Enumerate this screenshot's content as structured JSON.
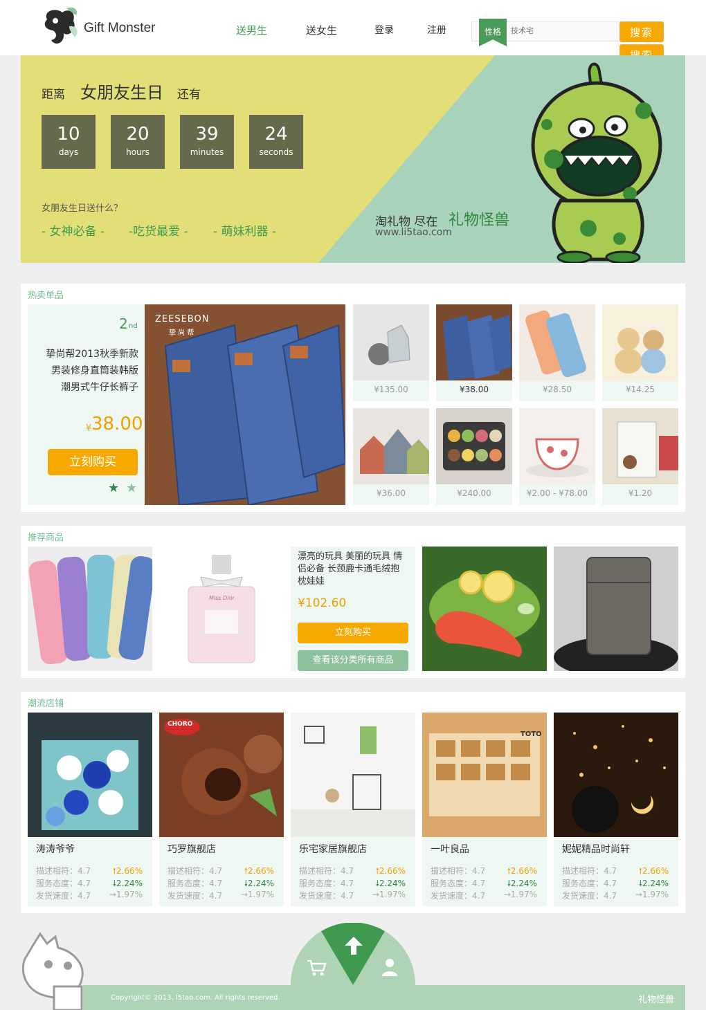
{
  "header": {
    "logo_text": "Gift Monster",
    "nav": [
      "送男生",
      "送女生",
      "登录",
      "注册"
    ],
    "search_tag": "性格",
    "search_placeholder": "技术宅",
    "search_button": "搜索"
  },
  "banner": {
    "prefix": "距离",
    "event": "女朋友生日",
    "suffix": "还有",
    "countdown": [
      {
        "num": "10",
        "unit": "days"
      },
      {
        "num": "20",
        "unit": "hours"
      },
      {
        "num": "39",
        "unit": "minutes"
      },
      {
        "num": "24",
        "unit": "seconds"
      }
    ],
    "question": "女朋友生日送什么？",
    "links": [
      "- 女神必备 -",
      "-吃货最爱 -",
      "- 萌妹利器 -"
    ],
    "slogan_a": "淘礼物 尽在",
    "slogan_b": "礼物怪兽",
    "site": "www.li5tao.com"
  },
  "hot": {
    "title": "热卖单品",
    "rank": "2",
    "rank_suffix": "nd",
    "product_name": [
      "挚尚帮2013秋季新款",
      "男装修身直筒装韩版",
      "潮男式牛仔长裤子"
    ],
    "currency": "¥",
    "price": "38.00",
    "buy": "立刻购买",
    "brand": "ZEESEBON",
    "brand_cn": "挚 尚 帮",
    "thumbs": [
      "¥135.00",
      "¥38.00",
      "¥28.50",
      "¥14.25",
      "¥36.00",
      "¥240.00",
      "¥2.00 - ¥78.00",
      "¥1.20"
    ]
  },
  "recommend": {
    "title": "推荐商品",
    "product_name": [
      "漂亮的玩具 美丽的玩具 情",
      "侣必备 长颈鹿卡通毛绒抱",
      "枕娃娃"
    ],
    "price": "¥102.60",
    "buy": "立刻购买",
    "view_all": "查看该分类所有商品",
    "perfume_label": "Miss Dior"
  },
  "stores": {
    "title": "潮流店铺",
    "labels": [
      "描述相符：4.7",
      "服务态度：4.7",
      "发货速度：4.7"
    ],
    "rates": [
      "2.66%",
      "2.24%",
      "1.97%"
    ],
    "items": [
      "涛涛爷爷",
      "巧罗旗舰店",
      "乐宅家居旗舰店",
      "一叶良品",
      "妮妮精品时尚轩"
    ],
    "choro": "CHORO",
    "choro_cn": "巧罗",
    "toto": "TOTO"
  },
  "footer": {
    "copyright": "Copyright© 2013, I5tao.com. All rights reserved.",
    "brand": "礼物怪兽"
  },
  "colors": {
    "accent_green": "#4a9a5a",
    "orange": "#f6a800",
    "pale_green": "#eef7f1"
  }
}
